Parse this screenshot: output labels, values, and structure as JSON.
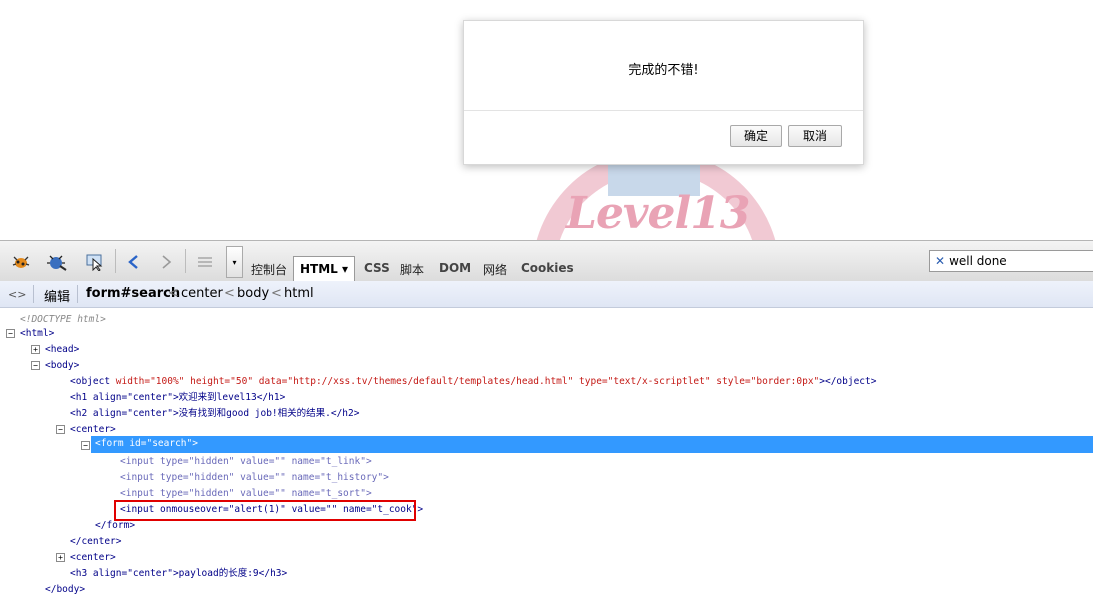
{
  "background": {
    "logo_text": "Level13"
  },
  "dialog": {
    "message": "完成的不错!",
    "ok_label": "确定",
    "cancel_label": "取消"
  },
  "toolbar": {
    "tabs": [
      "控制台",
      "HTML ▾",
      "CSS",
      "脚本",
      "DOM",
      "网络",
      "Cookies"
    ],
    "search_value": "well done",
    "search_clear": "✕"
  },
  "breadcrumb": {
    "icon": "<>",
    "edit_label": "编辑",
    "current": "form#search",
    "ancestors": [
      "center",
      "body",
      "html"
    ],
    "separator": "<"
  },
  "tree": {
    "doctype": "<!DOCTYPE html>",
    "lines": {
      "html_open": "<html>",
      "head": "<head>",
      "body_open": "<body>",
      "object_tag": "<object",
      "object_attrs": " width=\"100%\" height=\"50\" data=\"http://xss.tv/themes/default/templates/head.html\" type=\"text/x-scriptlet\" style=\"border:0px\"",
      "object_close": "></object>",
      "h1": "<h1 align=\"center\">欢迎来到level13</h1>",
      "h2": "<h2 align=\"center\">没有找到和good job!相关的结果.</h2>",
      "center_open": "<center>",
      "form_open": "<form id=\"search\">",
      "input1": "<input type=\"hidden\" value=\"\" name=\"t_link\">",
      "input2": "<input type=\"hidden\" value=\"\" name=\"t_history\">",
      "input3": "<input type=\"hidden\" value=\"\" name=\"t_sort\">",
      "input4": "<input onmouseover=\"alert(1)\" value=\"\" name=\"t_cook\">",
      "form_close": "</form>",
      "center_close": "</center>",
      "center2": "<center>",
      "h3": "<h3 align=\"center\">payload的长度:9</h3>",
      "body_close": "</body>"
    }
  }
}
